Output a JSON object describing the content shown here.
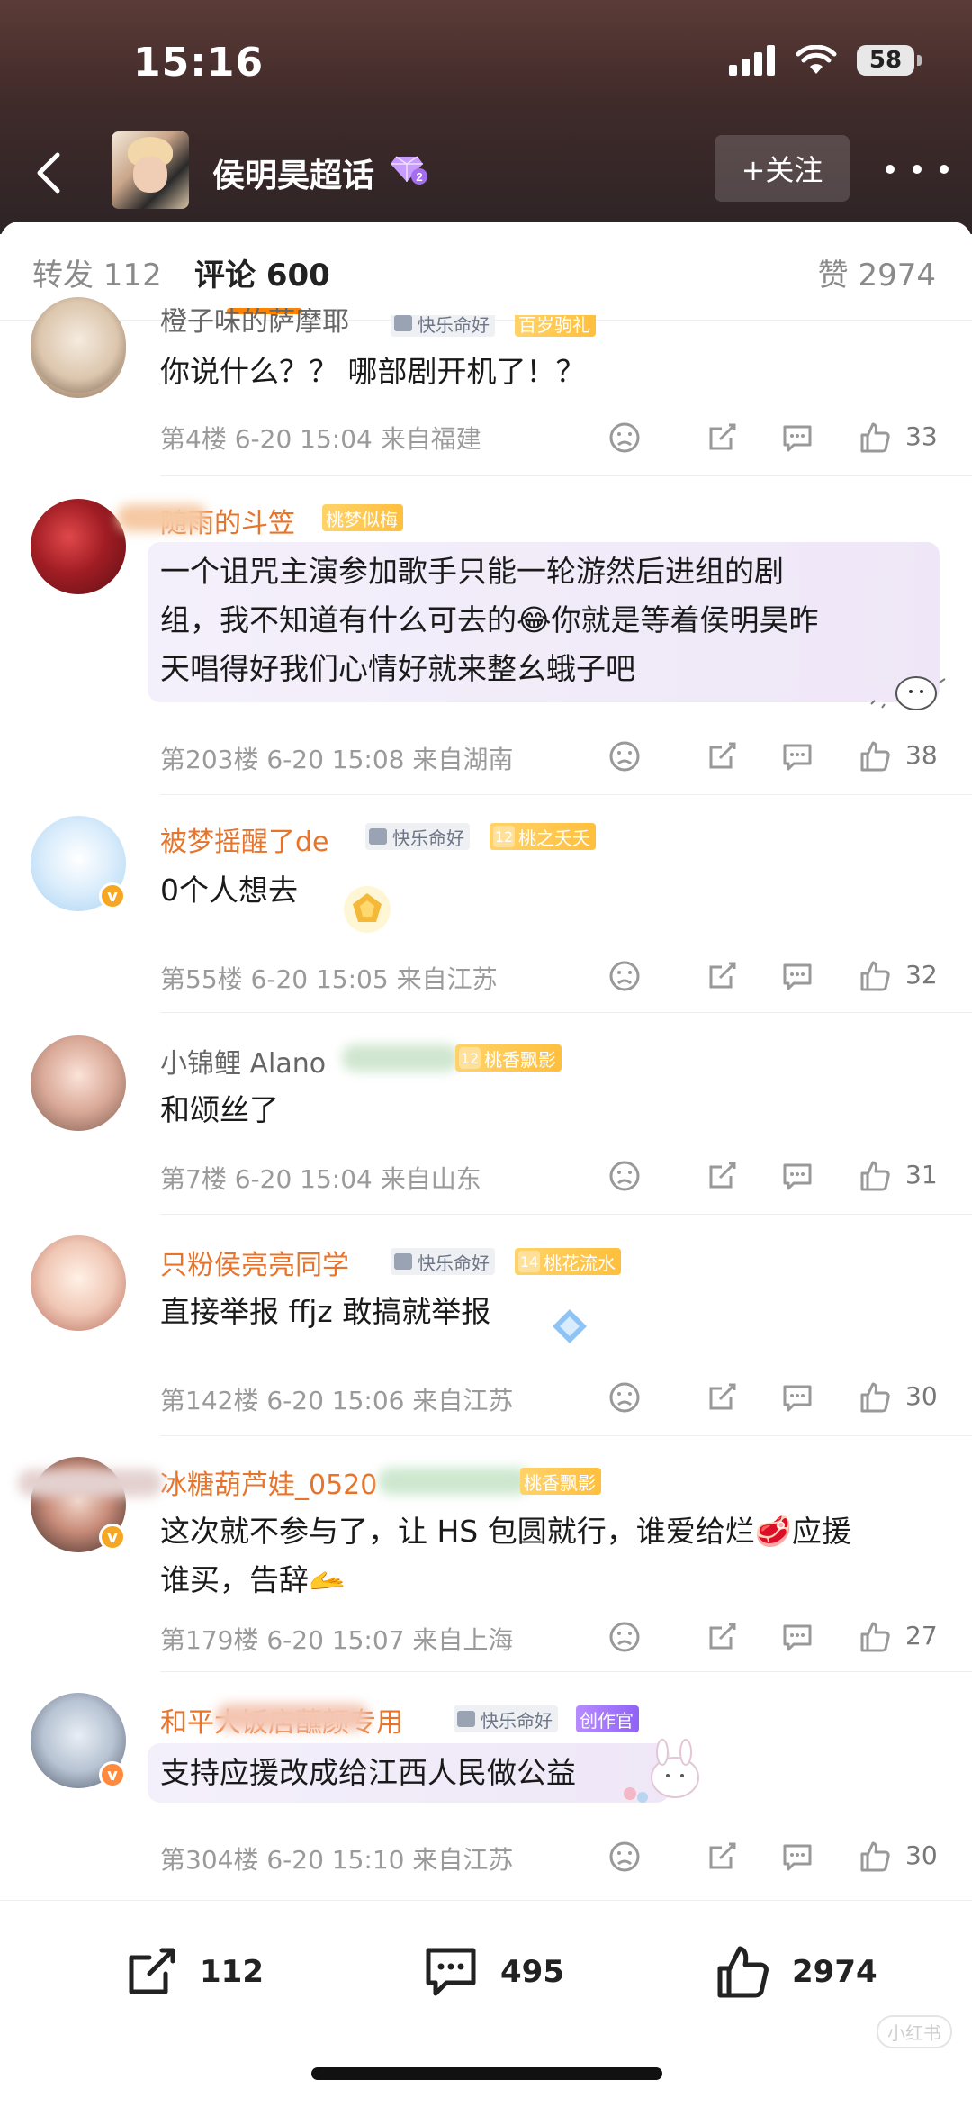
{
  "status": {
    "time": "15:16",
    "battery": "58"
  },
  "header": {
    "title": "侯明昊超话",
    "level": "2",
    "follow_label": "+关注"
  },
  "tabs": {
    "forward": "转发 112",
    "comments": "评论 600",
    "likes": "赞 2974"
  },
  "comments": [
    {
      "name": "橙子味的萨摩耶",
      "text": "你说什么？？ 哪部剧开机了！？",
      "meta": "第4楼 6-20 15:04 来自福建",
      "likes": "33",
      "tags": [
        {
          "type": "grey",
          "label": "快乐命好"
        },
        {
          "type": "gold",
          "label": "百岁驹礼"
        }
      ]
    },
    {
      "name": "随雨的斗笠",
      "text_lines": [
        "一个诅咒主演参加歌手只能一轮游然后进组的剧",
        "组，我不知道有什么可去的😂你就是等着侯明昊昨",
        "天唱得好我们心情好就来整幺蛾子吧"
      ],
      "meta": "第203楼 6-20 15:08 来自湖南",
      "likes": "38",
      "tags": [
        {
          "type": "gold",
          "label": "桃梦似梅"
        }
      ]
    },
    {
      "name": "被梦摇醒了de",
      "text": "0个人想去",
      "meta": "第55楼 6-20 15:05 来自江苏",
      "likes": "32",
      "tags": [
        {
          "type": "grey",
          "label": "快乐命好"
        },
        {
          "type": "gold",
          "level": "12",
          "label": "桃之夭夭"
        }
      ]
    },
    {
      "name": "小锦鲤 Alano",
      "text": "和颂丝了",
      "meta": "第7楼 6-20 15:04 来自山东",
      "likes": "31",
      "tags": [
        {
          "type": "gold",
          "level": "12",
          "label": "桃香飘影"
        }
      ]
    },
    {
      "name": "只粉侯亮亮同学",
      "text": "直接举报 ffjz 敢搞就举报",
      "meta": "第142楼 6-20 15:06 来自江苏",
      "likes": "30",
      "tags": [
        {
          "type": "grey",
          "label": "快乐命好"
        },
        {
          "type": "gold",
          "level": "14",
          "label": "桃花流水"
        }
      ]
    },
    {
      "name": "冰糖葫芦娃_0520",
      "text_lines": [
        "这次就不参与了，让 HS 包圆就行，谁爱给烂🥩应援",
        "谁买，告辞🫴"
      ],
      "meta": "第179楼 6-20 15:07 来自上海",
      "likes": "27",
      "tags": [
        {
          "type": "gold",
          "label": "桃香飘影"
        }
      ]
    },
    {
      "name": "和平大饭店蘸颜专用",
      "text": "支持应援改成给江西人民做公益",
      "meta": "第304楼 6-20 15:10 来自江苏",
      "likes": "30",
      "tags": [
        {
          "type": "grey",
          "label": "快乐命好"
        },
        {
          "type": "purple",
          "label": "创作官"
        }
      ]
    }
  ],
  "bottom_bar": {
    "forward": "112",
    "comments": "495",
    "likes": "2974"
  },
  "watermark": "小红书",
  "colors": {
    "accent": "#ff8200",
    "username": "#e8742c",
    "header_bg": "#3f2a2a"
  }
}
